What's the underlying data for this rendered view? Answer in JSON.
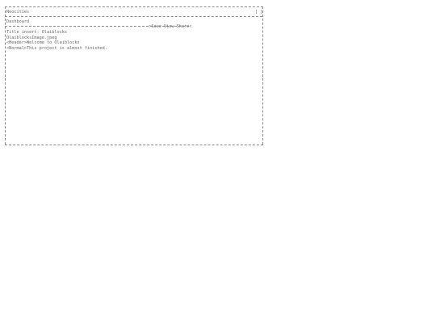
{
  "window": {
    "title": "Neocities",
    "close_label": "[ ]"
  },
  "toolbar": {
    "left_label": "Dashboard",
    "save_label": "Save",
    "view_label": "View",
    "share_label": "Share"
  },
  "editor": {
    "lines": [
      "Title insert: Olaiblocks",
      "OlaiblocksImage.jpeg",
      "<Header>Welcome to Olaiblocks",
      "<Normal>This project is almost finished."
    ]
  }
}
